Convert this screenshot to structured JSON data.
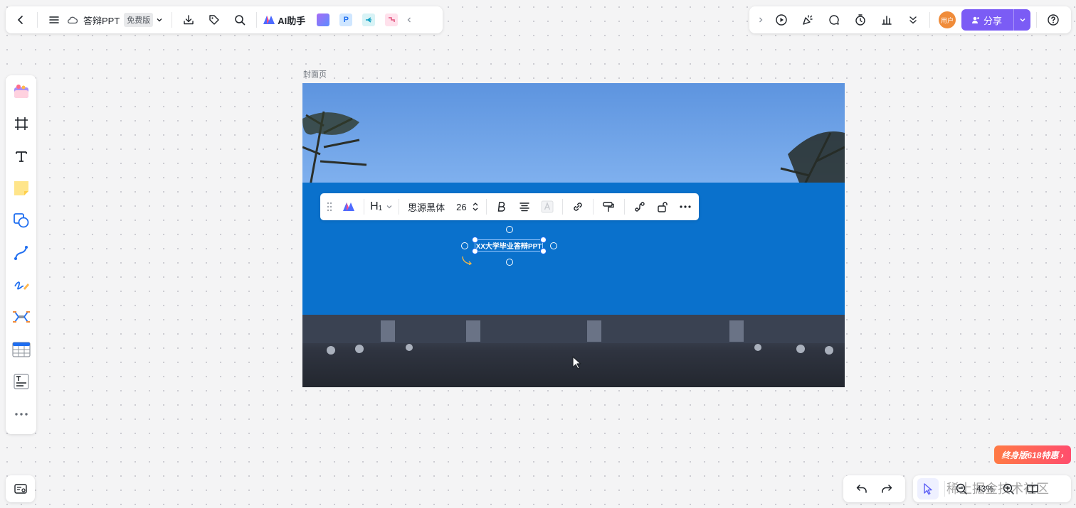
{
  "top_left_toolbar": {
    "doc_title": "答辩PPT",
    "plan_badge": "免费版",
    "ai_assistant_label": "AI助手",
    "mini_app_2_letter": "P"
  },
  "top_right_toolbar": {
    "avatar_text": "用户",
    "share_label": "分享"
  },
  "canvas": {
    "frame_label": "封面页",
    "selected_text": "XX大学毕业答辩PPT",
    "accent_color": "#0a71cc"
  },
  "text_toolbar": {
    "heading_label": "H",
    "heading_sub": "1",
    "font_family": "思源黑体",
    "font_size": "26"
  },
  "zoom": {
    "value": "43%"
  },
  "promo": {
    "label": "终身版618特惠 ›"
  },
  "watermark": "稀土掘金技术社区",
  "colors": {
    "primary": "#7b5cf5",
    "promo_start": "#ff7a45",
    "promo_end": "#ff4d6d"
  }
}
